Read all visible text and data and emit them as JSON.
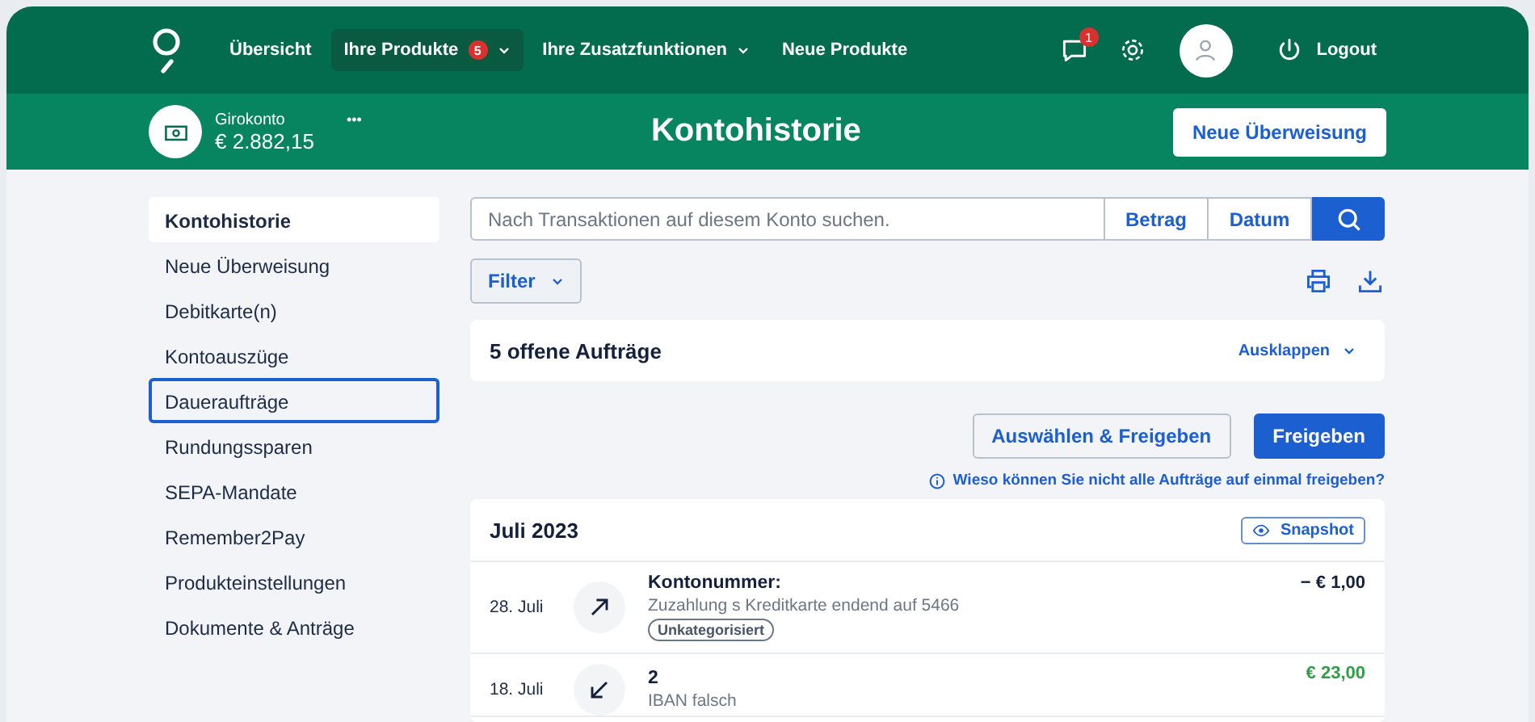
{
  "nav": {
    "items": [
      {
        "label": "Übersicht",
        "selected": false,
        "dropdown": false
      },
      {
        "label": "Ihre Produkte",
        "selected": true,
        "badge": "5",
        "dropdown": true
      },
      {
        "label": "Ihre Zusatzfunktionen",
        "selected": false,
        "dropdown": true
      },
      {
        "label": "Neue Produkte",
        "selected": false,
        "dropdown": false
      }
    ],
    "messages_badge": "1",
    "logout": "Logout"
  },
  "account": {
    "name": "Girokonto",
    "balance": "€ 2.882,15",
    "more": "•••"
  },
  "page_title": "Kontohistorie",
  "new_transfer_button": "Neue Überweisung",
  "sidebar": {
    "items": [
      {
        "label": "Kontohistorie",
        "selected": true,
        "focused": false
      },
      {
        "label": "Neue Überweisung",
        "selected": false,
        "focused": false
      },
      {
        "label": "Debitkarte(n)",
        "selected": false,
        "focused": false
      },
      {
        "label": "Kontoauszüge",
        "selected": false,
        "focused": false
      },
      {
        "label": "Daueraufträge",
        "selected": false,
        "focused": true
      },
      {
        "label": "Rundungssparen",
        "selected": false,
        "focused": false
      },
      {
        "label": "SEPA-Mandate",
        "selected": false,
        "focused": false
      },
      {
        "label": "Remember2Pay",
        "selected": false,
        "focused": false
      },
      {
        "label": "Produkteinstellungen",
        "selected": false,
        "focused": false
      },
      {
        "label": "Dokumente & Anträge",
        "selected": false,
        "focused": false
      }
    ]
  },
  "search": {
    "placeholder": "Nach Transaktionen auf diesem Konto suchen.",
    "buttons": [
      "Betrag",
      "Datum"
    ]
  },
  "filter_button": "Filter",
  "open_orders": {
    "title": "5 offene Aufträge",
    "toggle": "Ausklappen"
  },
  "actions": {
    "select_release": "Auswählen & Freigeben",
    "release": "Freigeben",
    "info": "Wieso können Sie nicht alle Aufträge auf einmal freigeben?"
  },
  "month": {
    "title": "Juli 2023",
    "snapshot": "Snapshot",
    "transactions": [
      {
        "date": "28. Juli",
        "kind": "outgoing",
        "title": "Kontonummer:",
        "description": "Zuzahlung s Kreditkarte endend auf 5466",
        "tag": "Unkategorisiert",
        "amount": "− € 1,00"
      },
      {
        "date": "18. Juli",
        "kind": "incoming",
        "title": "2",
        "description": "IBAN falsch",
        "amount": "€ 23,00"
      }
    ]
  }
}
